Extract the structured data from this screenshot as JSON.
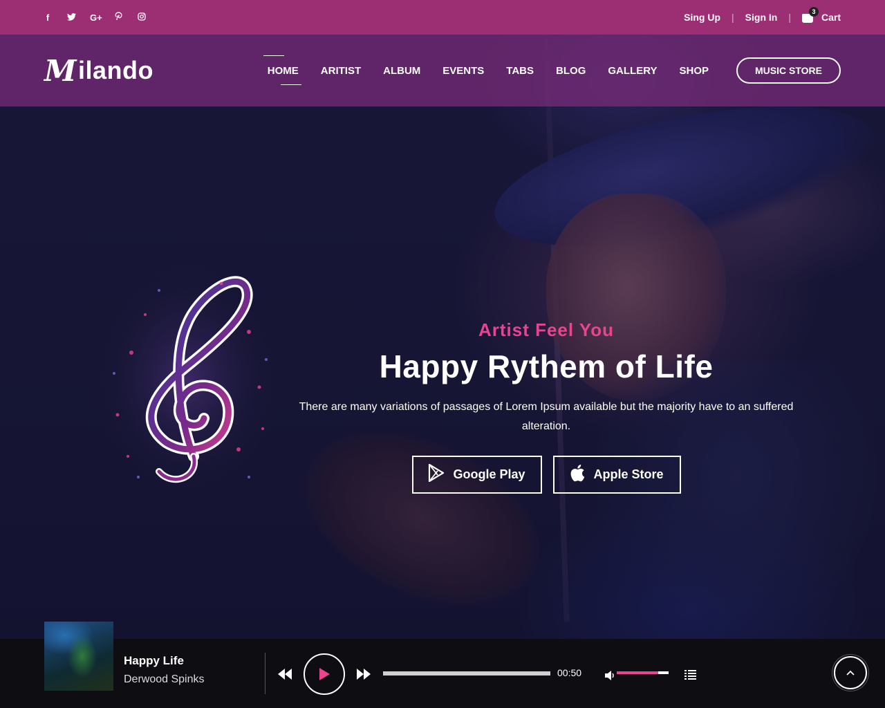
{
  "topbar": {
    "socials": [
      {
        "icon": "facebook-icon",
        "glyph": "f"
      },
      {
        "icon": "twitter-icon",
        "glyph": "t"
      },
      {
        "icon": "google-plus-icon",
        "glyph": "G+"
      },
      {
        "icon": "pinterest-icon",
        "glyph": "p"
      },
      {
        "icon": "instagram-icon",
        "glyph": "◎"
      }
    ],
    "signup": "Sing Up",
    "signin": "Sign In",
    "cart_label": "Cart",
    "cart_count": "3",
    "separator": "|"
  },
  "header": {
    "logo_mark": "M",
    "logo_text": "ilando",
    "nav": [
      "HOME",
      "ARITIST",
      "ALBUM",
      "EVENTS",
      "TABS",
      "BLOG",
      "GALLERY",
      "SHOP"
    ],
    "active_nav": "HOME",
    "cta": "MUSIC STORE"
  },
  "hero": {
    "subtitle": "Artist Feel You",
    "title": "Happy Rythem of Life",
    "description": "There are many variations of passages of Lorem Ipsum available but the majority have to an suffered alteration.",
    "google_play": "Google Play",
    "apple_store": "Apple Store"
  },
  "player": {
    "track_title": "Happy Life",
    "track_artist": "Derwood Spinks",
    "time": "00:50",
    "volume_level": 0.8,
    "progress": 0.0
  },
  "colors": {
    "accent": "#e8448f",
    "topbar": "#9c2f74",
    "header": "#742a76",
    "player_bg": "#0d0d12"
  }
}
